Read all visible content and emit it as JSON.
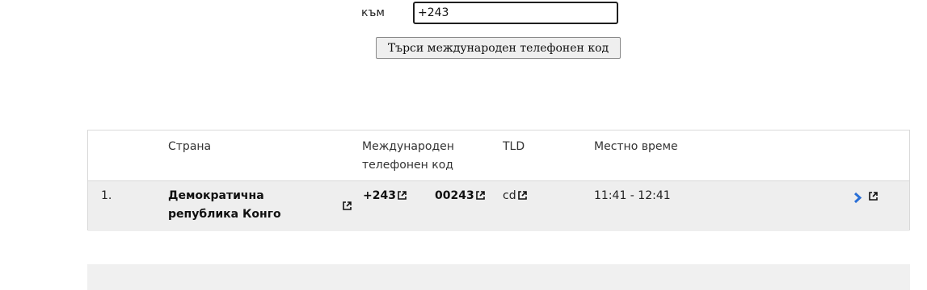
{
  "search": {
    "to_label": "към",
    "code_value": "+243",
    "button_label": "Търси международен телефонен код"
  },
  "table": {
    "headers": {
      "country": "Страна",
      "intl_code_line1": "Международен",
      "intl_code_line2": "телефонен код",
      "tld": "TLD",
      "local_time": "Местно време"
    },
    "rows": [
      {
        "index": "1.",
        "country_line1": "Демократична",
        "country_line2": "република Конго",
        "code_plus": "+243",
        "code_zeros": "00243",
        "tld": "cd",
        "local_time": "11:41 - 12:41"
      }
    ]
  },
  "colors": {
    "arrow": "#2a6fd6",
    "row_bg": "#eeeeee"
  },
  "icons": [
    "external-link-icon",
    "chevron-right-icon"
  ]
}
